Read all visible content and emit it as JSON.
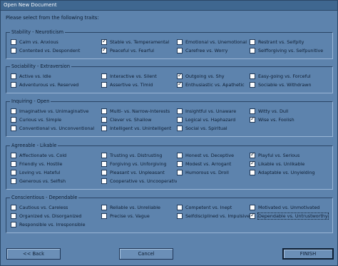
{
  "window": {
    "title": "Open New Document"
  },
  "prompt": "Please select from the following traits:",
  "groups": [
    {
      "title": "Stability - Neuroticism",
      "items": [
        {
          "label": "Calm vs. Anxious",
          "checked": false
        },
        {
          "label": "Stable vs. Temperamental",
          "checked": true
        },
        {
          "label": "Emotional vs. Unemotional",
          "checked": false
        },
        {
          "label": "Restrant vs. Selfpity",
          "checked": false
        },
        {
          "label": "Contented vs. Despondent",
          "checked": false
        },
        {
          "label": "Peaceful vs. Fearful",
          "checked": true
        },
        {
          "label": "Carefree vs. Worry",
          "checked": false
        },
        {
          "label": "Selfforgiving vs. Selfpunitive",
          "checked": false
        }
      ]
    },
    {
      "title": "Sociability - Extraversion",
      "items": [
        {
          "label": "Active vs. Idle",
          "checked": false
        },
        {
          "label": "Interactive vs. Silent",
          "checked": false
        },
        {
          "label": "Outgoing vs. Shy",
          "checked": true
        },
        {
          "label": "Easy-going vs. Forceful",
          "checked": false
        },
        {
          "label": "Adventurous vs. Reserved",
          "checked": false
        },
        {
          "label": "Assertive vs. Timid",
          "checked": false
        },
        {
          "label": "Enthusiastic vs. Apathetic",
          "checked": true
        },
        {
          "label": "Sociable vs. Withdrawn",
          "checked": false
        }
      ]
    },
    {
      "title": "Inquiring - Open",
      "items": [
        {
          "label": "Imaginative vs. Unimaginative",
          "checked": false
        },
        {
          "label": "Multi- vs. Narrow-Interests",
          "checked": false
        },
        {
          "label": "Insightful vs. Unaware",
          "checked": false
        },
        {
          "label": "Witty vs. Dull",
          "checked": false
        },
        {
          "label": "Curious vs. Simple",
          "checked": false
        },
        {
          "label": "Clever vs. Shallow",
          "checked": false
        },
        {
          "label": "Logical vs. Haphazard",
          "checked": false
        },
        {
          "label": "Wise vs. Foolish",
          "checked": true
        },
        {
          "label": "Conventional vs. Unconventional",
          "checked": false
        },
        {
          "label": "Intelligent vs. Unintelligent",
          "checked": false
        },
        {
          "label": "Social vs. Spiritual",
          "checked": false
        }
      ]
    },
    {
      "title": "Agreeable - Likable",
      "items": [
        {
          "label": "Affectionate vs. Cold",
          "checked": false
        },
        {
          "label": "Trusting vs. Distrusting",
          "checked": false
        },
        {
          "label": "Honest vs. Deceptive",
          "checked": false
        },
        {
          "label": "Playful vs. Serious",
          "checked": true
        },
        {
          "label": "Friendly vs. Hostile",
          "checked": false
        },
        {
          "label": "Forgiving vs. Unforgiving",
          "checked": false
        },
        {
          "label": "Modest vs. Arrogant",
          "checked": false
        },
        {
          "label": "Likable vs. Unlikable",
          "checked": true
        },
        {
          "label": "Loving vs. Hateful",
          "checked": false
        },
        {
          "label": "Pleasant vs. Unpleasant",
          "checked": false
        },
        {
          "label": "Humorous vs. Droll",
          "checked": false
        },
        {
          "label": "Adaptable vs. Unyielding",
          "checked": false
        },
        {
          "label": "Generous vs. Selfish",
          "checked": false
        },
        {
          "label": "Cooperative vs. Uncooperative",
          "checked": false
        }
      ]
    },
    {
      "title": "Conscientious - Dependable",
      "items": [
        {
          "label": "Cautious vs. Careless",
          "checked": false
        },
        {
          "label": "Reliable vs. Unreliable",
          "checked": false
        },
        {
          "label": "Competent vs. Inept",
          "checked": false
        },
        {
          "label": "Motivated vs. Unmotivated",
          "checked": false
        },
        {
          "label": "Organized vs. Disorganized",
          "checked": false
        },
        {
          "label": "Precise vs. Vague",
          "checked": false
        },
        {
          "label": "Selfdisciplined vs. Impulsive",
          "checked": false
        },
        {
          "label": "Dependable vs. Untrustworthy",
          "checked": true,
          "focused": true
        },
        {
          "label": "Responsible vs. Irresponsible",
          "checked": false
        }
      ]
    }
  ],
  "buttons": {
    "back": "<< Back",
    "cancel": "Cancel",
    "finish": "FINISH"
  }
}
